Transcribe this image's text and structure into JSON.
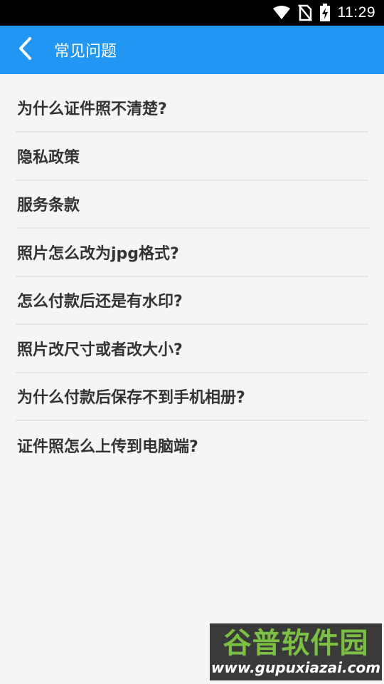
{
  "status_bar": {
    "time": "11:29",
    "icons": [
      "wifi-icon",
      "no-sim-icon",
      "battery-charging-icon"
    ]
  },
  "app_bar": {
    "back_icon": "chevron-left-icon",
    "title": "常见问题",
    "background": "#2196f3"
  },
  "faq": {
    "items": [
      {
        "label": "为什么证件照不清楚?"
      },
      {
        "label": "隐私政策"
      },
      {
        "label": "服务条款"
      },
      {
        "label": "照片怎么改为jpg格式?"
      },
      {
        "label": "怎么付款后还是有水印?"
      },
      {
        "label": "照片改尺寸或者改大小?"
      },
      {
        "label": "为什么付款后保存不到手机相册?"
      },
      {
        "label": "证件照怎么上传到电脑端?"
      }
    ]
  },
  "watermark": {
    "logo_text": "谷普软件园",
    "url": "www.gupuxiazai.com",
    "logo_color": "#7bc043"
  }
}
